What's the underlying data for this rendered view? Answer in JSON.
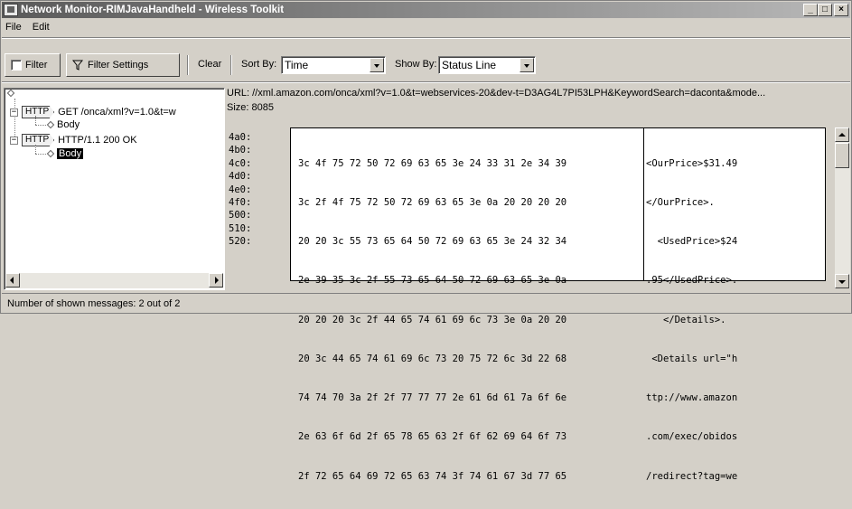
{
  "window": {
    "title": "Network Monitor-RIMJavaHandheld - Wireless Toolkit",
    "icon": "network-monitor-icon",
    "controls": [
      "_",
      "□",
      "×"
    ]
  },
  "menu": {
    "file": "File",
    "edit": "Edit"
  },
  "toolbar": {
    "filter_label": "Filter",
    "filter_checked": false,
    "filter_settings_label": "Filter Settings",
    "clear_label": "Clear",
    "sort_by_label": "Sort By:",
    "sort_by_value": "Time",
    "show_by_label": "Show By:",
    "show_by_value": "Status Line"
  },
  "tree": {
    "request_tag": "HTTP",
    "request_label": "GET /onca/xml?v=1.0&t=w",
    "request_body": "Body",
    "response_tag": "HTTP",
    "response_label": "HTTP/1.1 200 OK",
    "response_body": "Body"
  },
  "detail": {
    "url": "URL: //xml.amazon.com/onca/xml?v=1.0&t=webservices-20&dev-t=D3AG4L7PI53LPH&KeywordSearch=dacontа&mode...",
    "size": "Size: 8085",
    "rows": [
      {
        "addr": "4a0:",
        "hex": "3c 4f 75 72 50 72 69 63 65 3e 24 33 31 2e 34 39",
        "ascii": "<OurPrice>$31.49"
      },
      {
        "addr": "4b0:",
        "hex": "3c 2f 4f 75 72 50 72 69 63 65 3e 0a 20 20 20 20",
        "ascii": "</OurPrice>."
      },
      {
        "addr": "4c0:",
        "hex": "20 20 3c 55 73 65 64 50 72 69 63 65 3e 24 32 34",
        "ascii": "  <UsedPrice>$24"
      },
      {
        "addr": "4d0:",
        "hex": "2e 39 35 3c 2f 55 73 65 64 50 72 69 63 65 3e 0a",
        "ascii": ".95</UsedPrice>."
      },
      {
        "addr": "4e0:",
        "hex": "20 20 20 3c 2f 44 65 74 61 69 6c 73 3e 0a 20 20",
        "ascii": "   </Details>."
      },
      {
        "addr": "4f0:",
        "hex": "20 3c 44 65 74 61 69 6c 73 20 75 72 6c 3d 22 68",
        "ascii": " <Details url=\"h"
      },
      {
        "addr": "500:",
        "hex": "74 74 70 3a 2f 2f 77 77 77 2e 61 6d 61 7a 6f 6e",
        "ascii": "ttp://www.amazon"
      },
      {
        "addr": "510:",
        "hex": "2e 63 6f 6d 2f 65 78 65 63 2f 6f 62 69 64 6f 73",
        "ascii": ".com/exec/obidos"
      },
      {
        "addr": "520:",
        "hex": "2f 72 65 64 69 72 65 63 74 3f 74 61 67 3d 77 65",
        "ascii": "/redirect?tag=we"
      }
    ]
  },
  "status": {
    "text": "Number of shown messages: 2 out of 2"
  }
}
